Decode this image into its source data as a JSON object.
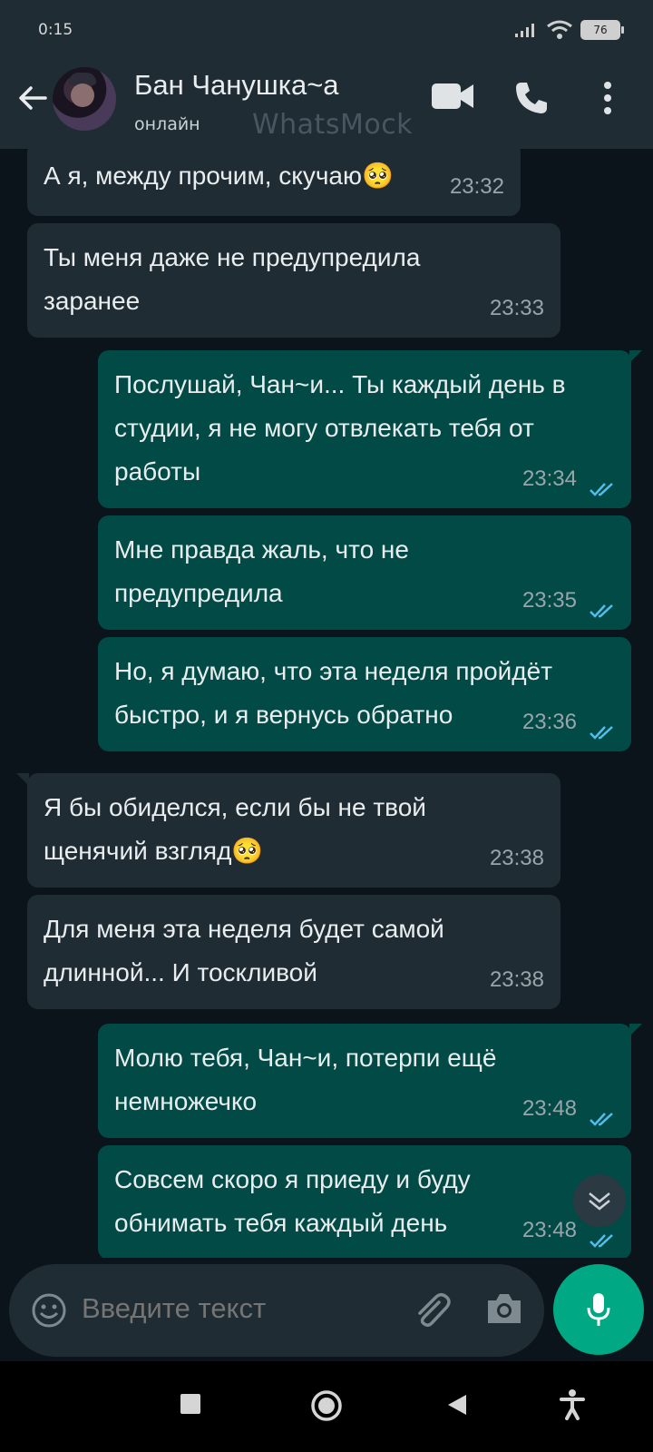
{
  "status_bar": {
    "time": "0:15",
    "battery": "76"
  },
  "header": {
    "contact_name": "Бан Чанушка~а",
    "contact_status": "онлайн",
    "watermark": "WhatsMock"
  },
  "messages": [
    {
      "direction": "in",
      "text": "А я, между прочим, скучаю",
      "emoji": "🥺",
      "time": "23:32"
    },
    {
      "direction": "in",
      "text": "Ты меня даже не предупредила заранее",
      "time": "23:33"
    },
    {
      "direction": "out",
      "text": "Послушай, Чан~и... Ты каждый день в студии, я не могу отвлекать тебя от работы",
      "time": "23:34",
      "read": true
    },
    {
      "direction": "out",
      "text": "Мне правда жаль, что не предупредила",
      "time": "23:35",
      "read": true
    },
    {
      "direction": "out",
      "text": "Но, я думаю, что эта неделя пройдёт быстро, и я вернусь обратно",
      "time": "23:36",
      "read": true
    },
    {
      "direction": "in",
      "text": "Я бы обиделся, если бы не твой щенячий взгляд",
      "emoji": "🥺",
      "time": "23:38"
    },
    {
      "direction": "in",
      "text": "Для меня эта неделя будет самой длинной... И тоскливой",
      "time": "23:38"
    },
    {
      "direction": "out",
      "text": "Молю тебя, Чан~и, потерпи ещё немножечко",
      "time": "23:48",
      "read": true
    },
    {
      "direction": "out",
      "text": "Совсем скоро я приеду и буду обнимать тебя каждый день",
      "time": "23:48",
      "read": true
    }
  ],
  "input": {
    "placeholder": "Введите текст"
  },
  "colors": {
    "background": "#0b141a",
    "header": "#1f2c33",
    "incoming_bubble": "#1f2c33",
    "outgoing_bubble": "#024a45",
    "read_ticks": "#53bdeb",
    "mic_button": "#00a884"
  },
  "icons": [
    "back-arrow-icon",
    "video-call-icon",
    "phone-icon",
    "more-vertical-icon",
    "emoji-icon",
    "attach-icon",
    "camera-icon",
    "mic-icon",
    "chevron-down-icon"
  ]
}
